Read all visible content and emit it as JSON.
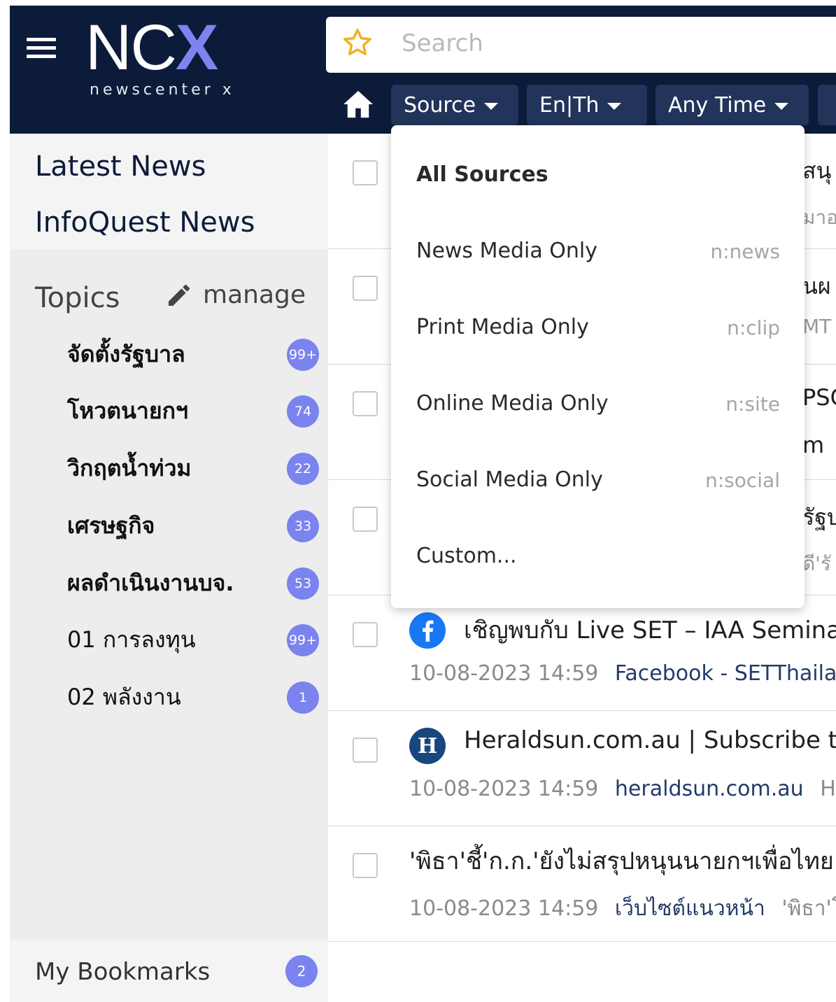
{
  "header": {
    "logo_text": "NC",
    "logo_x": "X",
    "logo_sub": "newscenter x",
    "search_placeholder": "Search",
    "filters": {
      "source": "Source",
      "language": "En|Th",
      "time": "Any Time"
    }
  },
  "sidebar": {
    "latest": "Latest News",
    "infoquest": "InfoQuest News",
    "topics_label": "Topics",
    "manage_label": "manage",
    "topics": [
      {
        "label": "จัดตั้งรัฐบาล",
        "count": "99+",
        "bold": true
      },
      {
        "label": "โหวตนายกฯ",
        "count": "74",
        "bold": true
      },
      {
        "label": "วิกฤตน้ำท่วม",
        "count": "22",
        "bold": true
      },
      {
        "label": "เศรษฐกิจ",
        "count": "33",
        "bold": true
      },
      {
        "label": "ผลดำเนินงานบจ.",
        "count": "53",
        "bold": true
      },
      {
        "label": "01 การลงทุน",
        "count": "99+",
        "bold": false
      },
      {
        "label": "02 พลังงาน",
        "count": "1",
        "bold": false
      }
    ],
    "bookmarks_label": "My Bookmarks",
    "bookmarks_count": "2"
  },
  "dropdown": {
    "items": [
      {
        "label": "All Sources",
        "key": ""
      },
      {
        "label": "News Media Only",
        "key": "n:news"
      },
      {
        "label": "Print Media Only",
        "key": "n:clip"
      },
      {
        "label": "Online Media Only",
        "key": "n:site"
      },
      {
        "label": "Social Media Only",
        "key": "n:social"
      },
      {
        "label": "Custom...",
        "key": ""
      }
    ]
  },
  "news": {
    "peeks": [
      "สนุ",
      "มาอ",
      "นผ",
      "MT",
      "PSC",
      "m",
      "รัฐบ",
      "ดี'รั"
    ],
    "rows": [
      {
        "title": "เชิญพบกับ Live SET – IAA Seminar",
        "date": "10-08-2023",
        "time": "14:59",
        "source": "Facebook - SETThailand",
        "snippet": "",
        "icon": "facebook-icon"
      },
      {
        "title": "Heraldsun.com.au | Subscribe to",
        "date": "10-08-2023",
        "time": "14:59",
        "source": "heraldsun.com.au",
        "snippet": "Her",
        "icon": "heraldsun-icon"
      },
      {
        "title": "'พิธา'ชี้'ก.ก.'ยังไม่สรุปหนุนนายกฯเพื่อไทย ร",
        "date": "10-08-2023",
        "time": "14:59",
        "source": "เว็บไซต์แนวหน้า",
        "snippet": "'พิธา'โผ",
        "icon": ""
      }
    ]
  },
  "colors": {
    "header_bg": "#0d1b3a",
    "filter_bg": "#22345a",
    "accent": "#7b83ee",
    "logo_x": "#7e83f0"
  }
}
